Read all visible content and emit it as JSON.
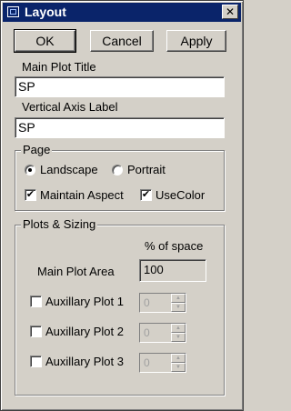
{
  "window": {
    "title": "Layout",
    "close_glyph": "✕"
  },
  "buttons": {
    "ok": "OK",
    "cancel": "Cancel",
    "apply": "Apply"
  },
  "main_plot_title": {
    "label": "Main Plot Title",
    "value": "SP"
  },
  "vertical_axis_label": {
    "label": "Vertical Axis Label",
    "value": "SP"
  },
  "page": {
    "group_title": "Page",
    "landscape": {
      "label": "Landscape",
      "selected": true
    },
    "portrait": {
      "label": "Portrait",
      "selected": false
    },
    "maintain_aspect": {
      "label": "Maintain Aspect",
      "checked": true
    },
    "use_color": {
      "label": "UseColor",
      "checked": true
    }
  },
  "plots_sizing": {
    "group_title": "Plots & Sizing",
    "pct_header": "% of space",
    "main_plot_area": {
      "label": "Main Plot Area",
      "value": "100"
    },
    "aux1": {
      "label": "Auxillary Plot 1",
      "value": "0",
      "checked": false
    },
    "aux2": {
      "label": "Auxillary Plot 2",
      "value": "0",
      "checked": false
    },
    "aux3": {
      "label": "Auxillary Plot 3",
      "value": "0",
      "checked": false
    }
  },
  "glyphs": {
    "check": "✔",
    "up": "▲",
    "down": "▼"
  }
}
